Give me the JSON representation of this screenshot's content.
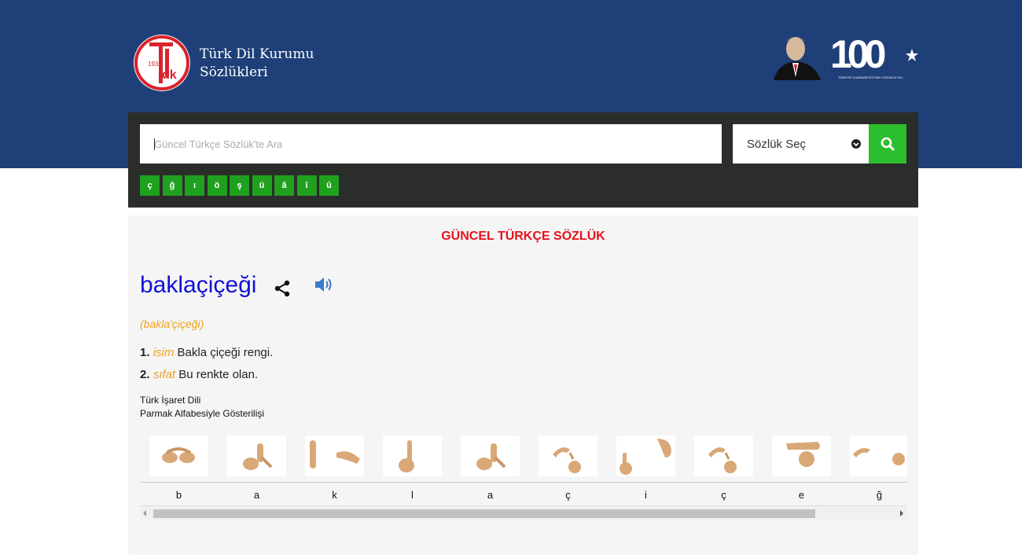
{
  "header": {
    "logo_year": "1932",
    "brand_line1": "Türk Dil Kurumu",
    "brand_line2": "Sözlükleri",
    "centennial_mark": "100",
    "centennial_caption": "TÜRKİYE CUMHURİYETİ'NİN YÜZÜNCÜ YILI"
  },
  "search": {
    "placeholder": "Güncel Türkçe Sözlük'te Ara",
    "value": "",
    "dictionary_select_label": "Sözlük Seç",
    "button_icon": "search-icon",
    "special_chars": [
      "ç",
      "ğ",
      "ı",
      "ö",
      "ş",
      "ü",
      "â",
      "î",
      "û"
    ]
  },
  "result": {
    "dictionary_title": "GÜNCEL TÜRKÇE SÖZLÜK",
    "word": "baklaçiçeği",
    "syllabification": "(bakla'çiçeği)",
    "meanings": [
      {
        "num": "1.",
        "pos": "isim",
        "text": "Bakla çiçeği rengi."
      },
      {
        "num": "2.",
        "pos": "sıfat",
        "text": "Bu renkte olan."
      }
    ],
    "sign_language_title_1": "Türk İşaret Dili",
    "sign_language_title_2": "Parmak Alfabesiyle Gösterilişi",
    "sign_letters": [
      "b",
      "a",
      "k",
      "l",
      "a",
      "ç",
      "i",
      "ç",
      "e",
      "ğ"
    ]
  },
  "colors": {
    "header_bg": "#1f3f78",
    "search_panel_bg": "#2b2d2b",
    "accent_green": "#2dbe2d",
    "title_red": "#e8111a",
    "word_blue": "#1010d8",
    "pos_orange": "#f0a020"
  }
}
